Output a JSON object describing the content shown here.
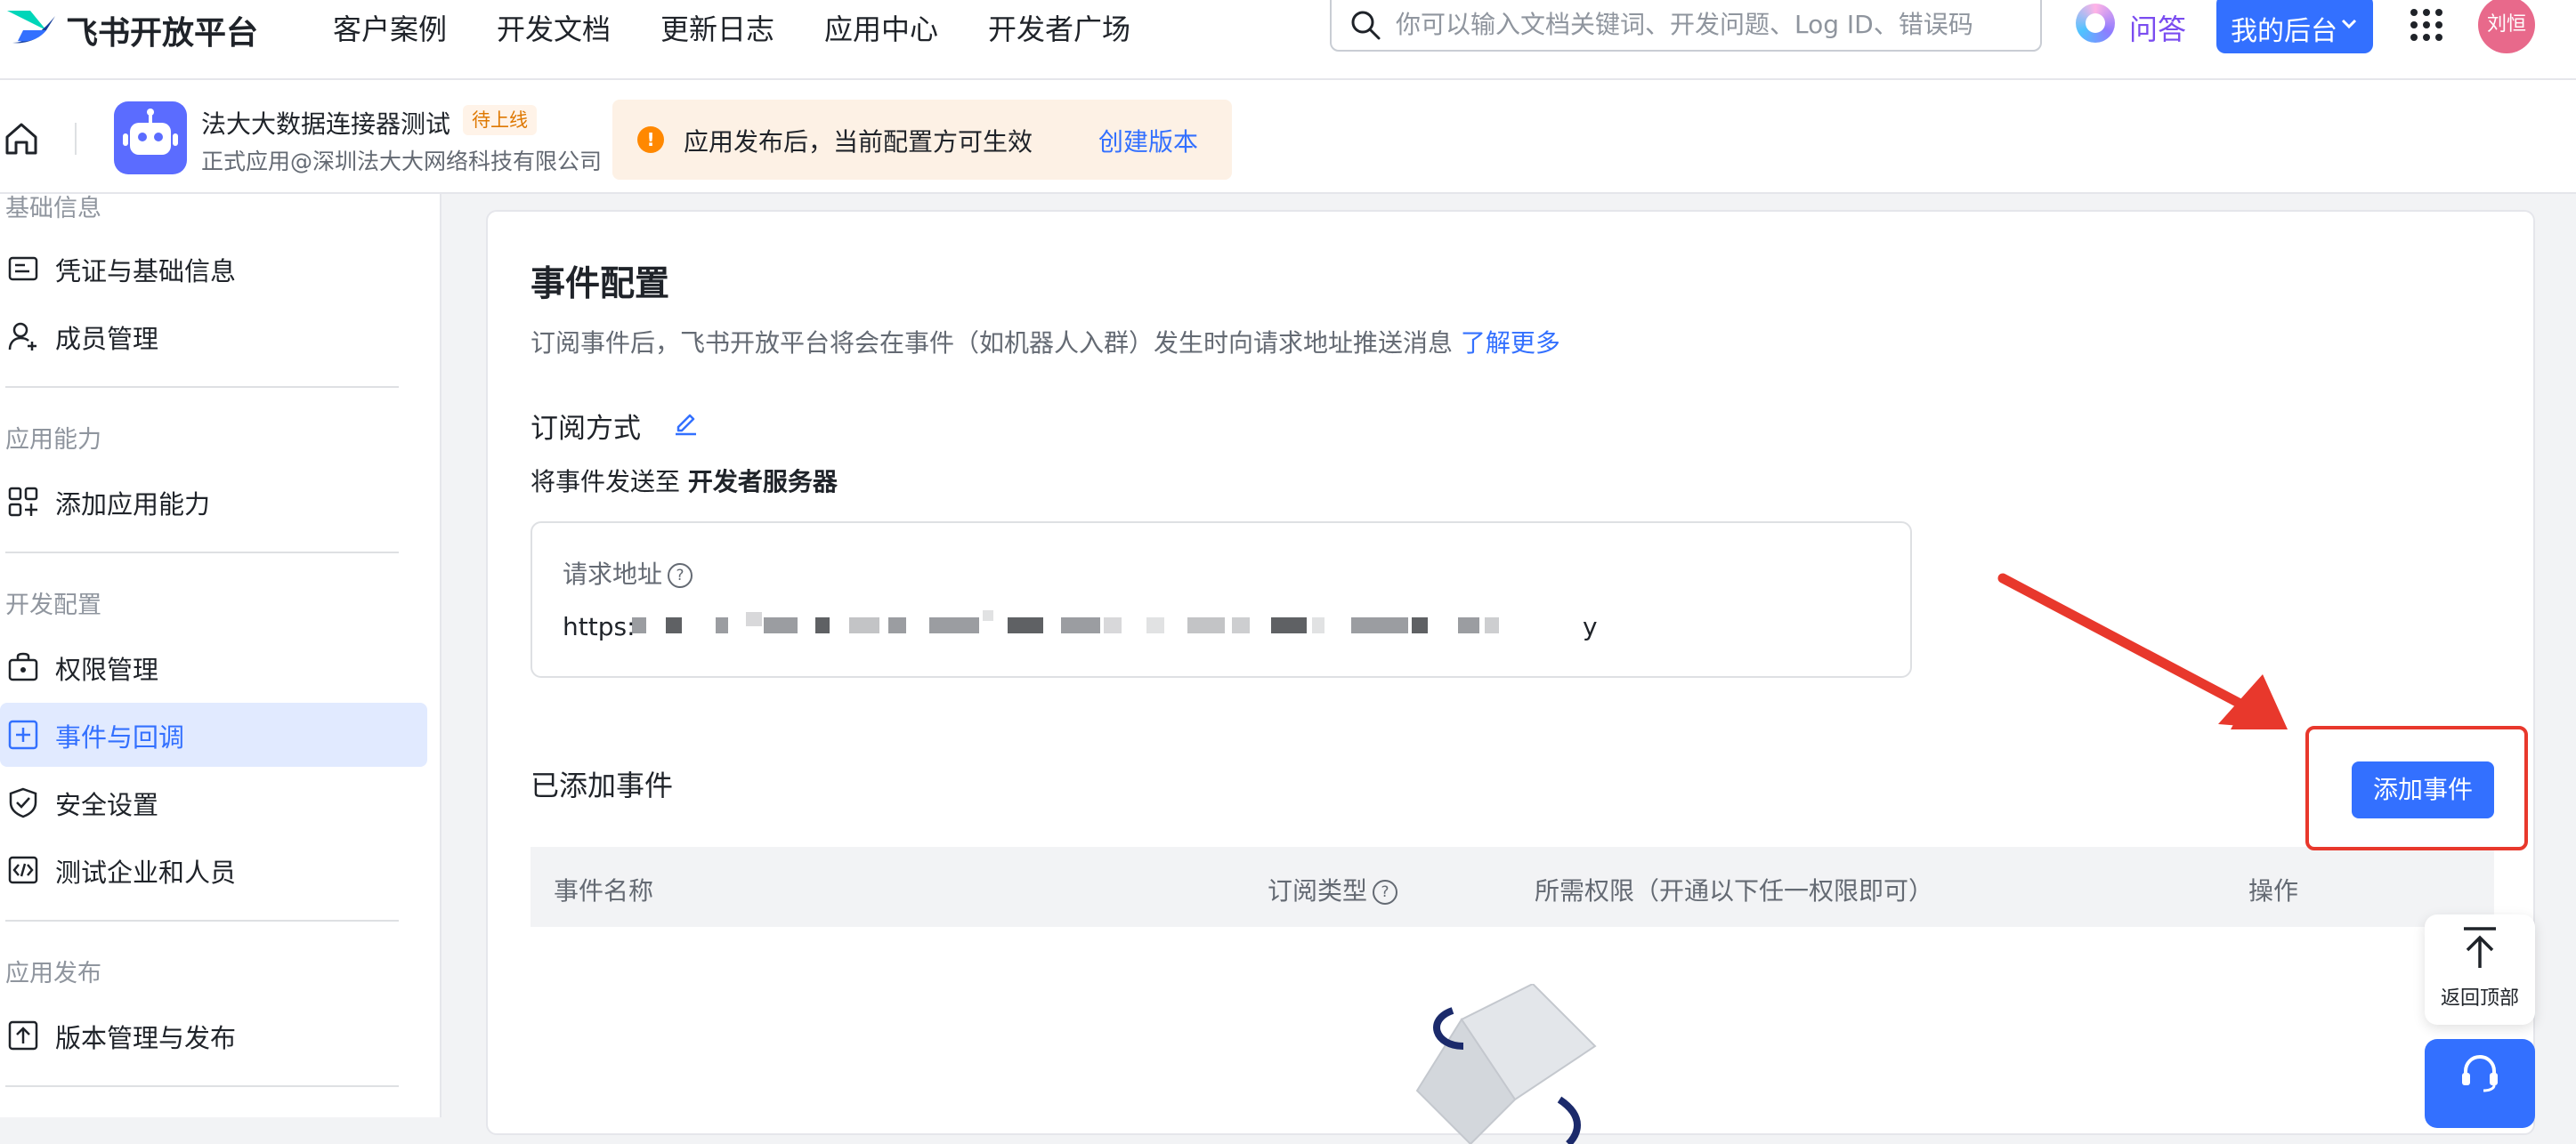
{
  "brand": {
    "name": "飞书开放平台"
  },
  "nav": {
    "links": [
      "客户案例",
      "开发文档",
      "更新日志",
      "应用中心",
      "开发者广场"
    ],
    "search_placeholder": "你可以输入文档关键词、开发问题、Log ID、错误码",
    "qa_label": "问答",
    "my_console_label": "我的后台",
    "avatar_text": "刘恒"
  },
  "app": {
    "name": "法大大数据连接器测试",
    "badge": "待上线",
    "subtitle": "正式应用@深圳法大大网络科技有限公司",
    "notice_text": "应用发布后，当前配置方可生效",
    "notice_link": "创建版本"
  },
  "sidebar": {
    "groups": [
      "基础信息",
      "应用能力",
      "开发配置",
      "应用发布"
    ],
    "items": [
      {
        "label": "凭证与基础信息",
        "icon": "id-card-icon"
      },
      {
        "label": "成员管理",
        "icon": "user-add-icon"
      },
      {
        "label": "添加应用能力",
        "icon": "apps-add-icon"
      },
      {
        "label": "权限管理",
        "icon": "permission-icon"
      },
      {
        "label": "事件与回调",
        "icon": "event-icon",
        "active": true
      },
      {
        "label": "安全设置",
        "icon": "shield-icon"
      },
      {
        "label": "测试企业和人员",
        "icon": "code-icon"
      },
      {
        "label": "版本管理与发布",
        "icon": "upload-icon"
      }
    ]
  },
  "main": {
    "title": "事件配置",
    "desc": "订阅事件后，飞书开放平台将会在事件（如机器人入群）发生时向请求地址推送消息",
    "desc_link": "了解更多",
    "subscribe_title": "订阅方式",
    "send_prefix": "将事件发送至",
    "send_target": "开发者服务器",
    "url_label": "请求地址",
    "url_prefix": "https:",
    "url_suffix": "y",
    "added_title": "已添加事件",
    "add_button": "添加事件",
    "table_headers": [
      "事件名称",
      "订阅类型",
      "所需权限（开通以下任一权限即可）",
      "操作"
    ]
  },
  "float": {
    "back_to_top": "返回顶部"
  },
  "colors": {
    "primary": "#3370ff",
    "annotation": "#e8382c",
    "badge": "#de7802",
    "notice_bg": "#fdf1e5"
  }
}
